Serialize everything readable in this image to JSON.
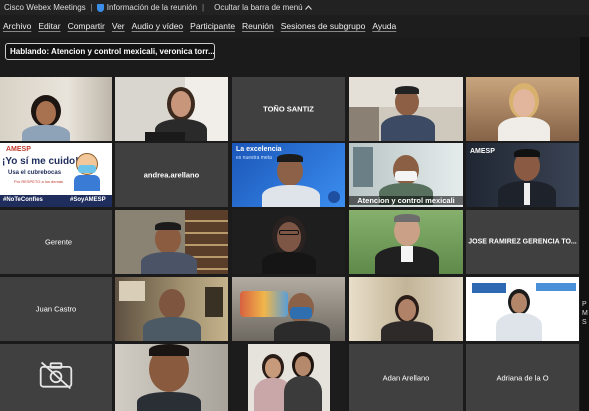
{
  "titlebar": {
    "app_name": "Cisco Webex Meetings",
    "separator": "|",
    "meeting_info": "Información de la reunión",
    "hide_menu": "Ocultar la barra de menú"
  },
  "menu": [
    "Archivo",
    "Editar",
    "Compartir",
    "Ver",
    "Audio y vídeo",
    "Participante",
    "Reunión",
    "Sesiones de subgrupo",
    "Ayuda"
  ],
  "speaking": "Hablando: Atencion y control mexicali, veronica torr...",
  "tiles": {
    "tono": "TOÑO SANTIZ",
    "andrea": "andrea.arellano",
    "atencion": "Atencion y control mexicali",
    "gerente": "Gerente",
    "jose": "JOSE RAMIREZ GERENCIA TO...",
    "juan": "Juan Castro",
    "adan": "Adan Arellano",
    "adriana": "Adriana de la O"
  },
  "poster_amesp": {
    "brand": "AMESP",
    "line1": "¡Yo sí me cuido!",
    "line2": "Usa el cubrebocas",
    "line3": "Por RESPETO a los demás",
    "tag1": "#NoTeConfíes",
    "tag2": "#SoyAMESP"
  },
  "banner_blue": {
    "line1": "La excelencia",
    "line2": "es nuestra meta"
  },
  "amesp_logo": "AMESP",
  "side_letters": [
    "P",
    "M",
    "S"
  ],
  "colors": {
    "selected_outline": "#2fbf4c",
    "blue_banner": "#2a6fd6"
  }
}
